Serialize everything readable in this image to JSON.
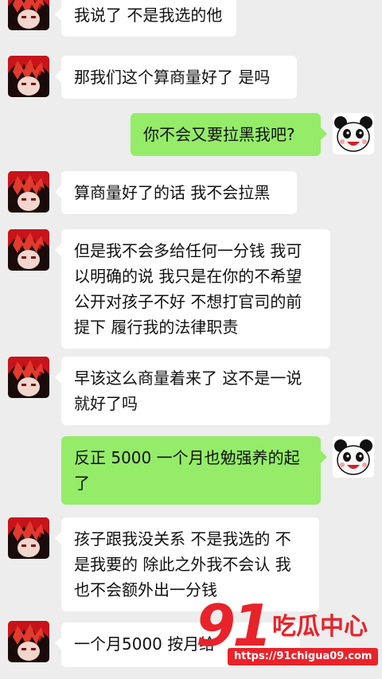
{
  "messages": [
    {
      "side": "in",
      "text": "我说了 不是我选的他"
    },
    {
      "side": "in",
      "text": "那我们这个算商量好了 是吗"
    },
    {
      "side": "out",
      "text": "你不会又要拉黑我吧?"
    },
    {
      "side": "in",
      "text": "算商量好了的话 我不会拉黑"
    },
    {
      "side": "in",
      "text": "但是我不会多给任何一分钱 我可以明确的说 我只是在你的不希望公开对孩子不好 不想打官司的前提下 履行我的法律职责"
    },
    {
      "side": "in",
      "text": "早该这么商量着来了 这不是一说就好了吗"
    },
    {
      "side": "out",
      "text": "反正 5000 一个月也勉强养的起了"
    },
    {
      "side": "in",
      "text": "孩子跟我没关系 不是我选的 不是我要的 除此之外我不会认 我也不会额外出一分钱"
    },
    {
      "side": "in",
      "text": "一个月5000 按月给"
    }
  ],
  "avatars": {
    "incoming": "red-hair-anime-avatar",
    "outgoing": "panda-cartoon-avatar"
  },
  "watermark": {
    "logo_number": "91",
    "logo_text": "吃瓜中心",
    "url": "https://91chigua09.com",
    "color": "#e8232a"
  },
  "colors": {
    "background": "#ededed",
    "incoming_bubble": "#ffffff",
    "outgoing_bubble": "#95ec69"
  }
}
